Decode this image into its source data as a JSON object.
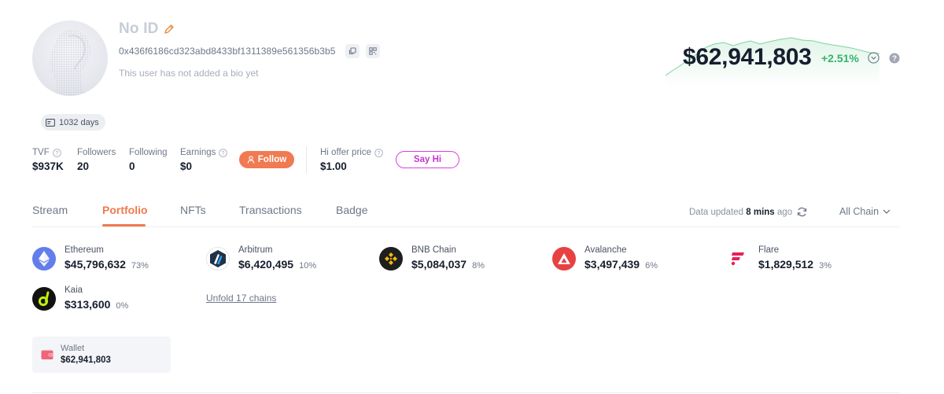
{
  "profile": {
    "name": "No ID",
    "address": "0x436f6186cd323abd8433bf1311389e561356b3b5",
    "bio": "This user has not added a bio yet",
    "days": "1032 days"
  },
  "summary": {
    "total_value": "$62,941,803",
    "change": "+2.51%",
    "change_color": "#35b46a"
  },
  "stats": {
    "tvf": {
      "label": "TVF",
      "value": "$937K"
    },
    "followers": {
      "label": "Followers",
      "value": "20"
    },
    "following": {
      "label": "Following",
      "value": "0"
    },
    "earnings": {
      "label": "Earnings",
      "value": "$0"
    },
    "follow_label": "Follow",
    "hi_offer": {
      "label": "Hi offer price",
      "value": "$1.00"
    },
    "say_hi_label": "Say Hi"
  },
  "tabs": [
    {
      "label": "Stream"
    },
    {
      "label": "Portfolio",
      "active": true
    },
    {
      "label": "NFTs"
    },
    {
      "label": "Transactions"
    },
    {
      "label": "Badge"
    }
  ],
  "toolbar": {
    "updated_prefix": "Data updated",
    "updated_time": "8 mins",
    "updated_suffix": "ago",
    "chain_filter": "All Chain"
  },
  "chains": [
    {
      "name": "Ethereum",
      "value": "$45,796,632",
      "percent": "73%",
      "icon": "ethereum-icon",
      "color": "#627eea"
    },
    {
      "name": "Arbitrum",
      "value": "$6,420,495",
      "percent": "10%",
      "icon": "arbitrum-icon",
      "color": "#213147"
    },
    {
      "name": "BNB Chain",
      "value": "$5,084,037",
      "percent": "8%",
      "icon": "bnb-chain-icon",
      "color": "#f0b90b"
    },
    {
      "name": "Avalanche",
      "value": "$3,497,439",
      "percent": "6%",
      "icon": "avalanche-icon",
      "color": "#e84142"
    },
    {
      "name": "Flare",
      "value": "$1,829,512",
      "percent": "3%",
      "icon": "flare-icon",
      "color": "#e62058"
    },
    {
      "name": "Kaia",
      "value": "$313,600",
      "percent": "0%",
      "icon": "kaia-icon",
      "color": "#bff009"
    }
  ],
  "unfold_label": "Unfold 17 chains",
  "wallet": {
    "label": "Wallet",
    "value": "$62,941,803",
    "color": "#f0657a"
  }
}
